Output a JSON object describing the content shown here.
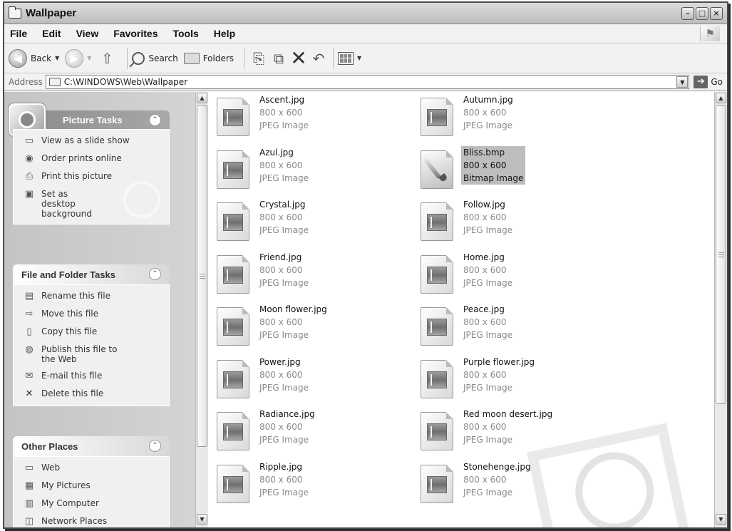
{
  "window": {
    "title": "Wallpaper",
    "buttons": [
      "minimize",
      "maximize",
      "close"
    ]
  },
  "menu": [
    "File",
    "Edit",
    "View",
    "Favorites",
    "Tools",
    "Help"
  ],
  "toolbar": {
    "back_label": "Back",
    "search_label": "Search",
    "folders_label": "Folders"
  },
  "address": {
    "label": "Address",
    "value": "C:\\WINDOWS\\Web\\Wallpaper",
    "go_label": "Go"
  },
  "sidebar": {
    "picture_tasks": {
      "title": "Picture Tasks",
      "items": [
        "View as a slide show",
        "Order prints online",
        "Print this picture",
        "Set as desktop background"
      ]
    },
    "file_tasks": {
      "title": "File and Folder Tasks",
      "items": [
        "Rename this file",
        "Move this file",
        "Copy this file",
        "Publish this file to the Web",
        "E-mail this file",
        "Delete this file"
      ]
    },
    "other_places": {
      "title": "Other Places",
      "items": [
        "Web",
        "My Pictures",
        "My Computer",
        "Network Places"
      ]
    }
  },
  "files": [
    {
      "name": "Ascent.jpg",
      "dims": "800 x 600",
      "type": "JPEG Image"
    },
    {
      "name": "Autumn.jpg",
      "dims": "800 x 600",
      "type": "JPEG Image"
    },
    {
      "name": "Azul.jpg",
      "dims": "800 x 600",
      "type": "JPEG Image"
    },
    {
      "name": "Bliss.bmp",
      "dims": "800 x 600",
      "type": "Bitmap Image",
      "selected": true
    },
    {
      "name": "Crystal.jpg",
      "dims": "800 x 600",
      "type": "JPEG Image"
    },
    {
      "name": "Follow.jpg",
      "dims": "800 x 600",
      "type": "JPEG Image"
    },
    {
      "name": "Friend.jpg",
      "dims": "800 x 600",
      "type": "JPEG Image"
    },
    {
      "name": "Home.jpg",
      "dims": "800 x 600",
      "type": "JPEG Image"
    },
    {
      "name": "Moon flower.jpg",
      "dims": "800 x 600",
      "type": "JPEG Image"
    },
    {
      "name": "Peace.jpg",
      "dims": "800 x 600",
      "type": "JPEG Image"
    },
    {
      "name": "Power.jpg",
      "dims": "800 x 600",
      "type": "JPEG Image"
    },
    {
      "name": "Purple flower.jpg",
      "dims": "800 x 600",
      "type": "JPEG Image"
    },
    {
      "name": "Radiance.jpg",
      "dims": "800 x 600",
      "type": "JPEG Image"
    },
    {
      "name": "Red moon desert.jpg",
      "dims": "800 x 600",
      "type": "JPEG Image"
    },
    {
      "name": "Ripple.jpg",
      "dims": "800 x 600",
      "type": "JPEG Image"
    },
    {
      "name": "Stonehenge.jpg",
      "dims": "800 x 600",
      "type": "JPEG Image"
    }
  ]
}
